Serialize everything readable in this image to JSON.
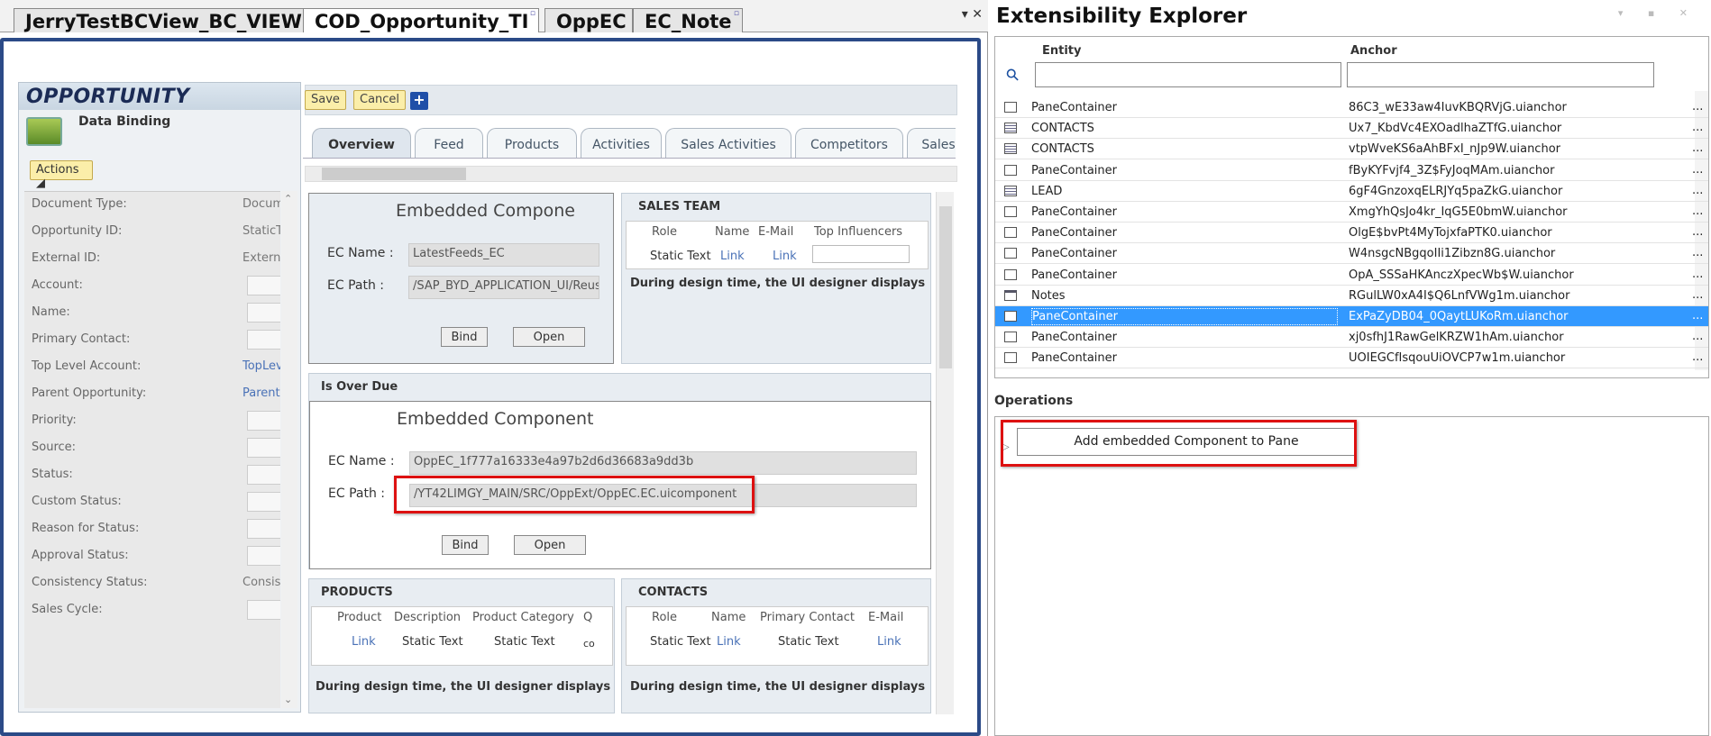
{
  "doc_tabs": [
    {
      "label": "JerryTestBCView_BC_VIEW",
      "active": false,
      "locked": false
    },
    {
      "label": "COD_Opportunity_TI",
      "active": true,
      "locked": true
    },
    {
      "label": "OppEC",
      "active": false,
      "locked": false
    },
    {
      "label": "EC_Note",
      "active": false,
      "locked": true
    }
  ],
  "tabstrip_controls": "▾ ✕",
  "sidebar": {
    "title": "OPPORTUNITY",
    "subtitle": "Data Binding",
    "actions_label": "Actions ◢",
    "fields": [
      {
        "label": "Document Type:",
        "value": "Document",
        "kind": "text"
      },
      {
        "label": "Opportunity ID:",
        "value": "StaticText",
        "kind": "text"
      },
      {
        "label": "External ID:",
        "value": "External",
        "kind": "text"
      },
      {
        "label": "Account:",
        "value": "",
        "kind": "box"
      },
      {
        "label": "Name:",
        "value": "",
        "kind": "box"
      },
      {
        "label": "Primary Contact:",
        "value": "",
        "kind": "box"
      },
      {
        "label": "Top Level Account:",
        "value": "TopLevel",
        "kind": "link"
      },
      {
        "label": "Parent Opportunity:",
        "value": "Parent",
        "kind": "link"
      },
      {
        "label": "Priority:",
        "value": "",
        "kind": "box"
      },
      {
        "label": "Source:",
        "value": "",
        "kind": "box"
      },
      {
        "label": "Status:",
        "value": "",
        "kind": "box"
      },
      {
        "label": "Custom Status:",
        "value": "",
        "kind": "box"
      },
      {
        "label": "Reason for Status:",
        "value": "",
        "kind": "box"
      },
      {
        "label": "Approval Status:",
        "value": "",
        "kind": "box"
      },
      {
        "label": "Consistency Status:",
        "value": "Consistent",
        "kind": "text"
      },
      {
        "label": "Sales Cycle:",
        "value": "",
        "kind": "box"
      }
    ]
  },
  "toolbar": {
    "save": "Save",
    "cancel": "Cancel",
    "plus": "+"
  },
  "view_tabs": [
    "Overview",
    "Feed",
    "Products",
    "Activities",
    "Sales Activities",
    "Competitors",
    "Sales"
  ],
  "ec1": {
    "title": "Embedded Component",
    "name_label": "EC Name :",
    "name_value": "LatestFeeds_EC",
    "path_label": "EC Path :",
    "path_value": "/SAP_BYD_APPLICATION_UI/Reuse",
    "bind": "Bind",
    "open": "Open"
  },
  "sales_team": {
    "title": "SALES TEAM",
    "columns": [
      "Role",
      "Name",
      "E-Mail",
      "Top Influencers"
    ],
    "row": [
      "Static Text",
      "Link",
      "Link",
      ""
    ],
    "note": "During design time, the UI designer displays only"
  },
  "overdue": {
    "title": "Is Over Due",
    "ec_title": "Embedded Component",
    "name_label": "EC Name :",
    "name_value": "OppEC_1f777a16333e4a97b2d6d36683a9dd3b",
    "path_label": "EC Path :",
    "path_value": "/YT42LIMGY_MAIN/SRC/OppExt/OppEC.EC.uicomponent",
    "bind": "Bind",
    "open": "Open"
  },
  "products": {
    "title": "PRODUCTS",
    "columns": [
      "Product",
      "Description",
      "Product Category",
      "Q"
    ],
    "row": [
      "Link",
      "Static Text",
      "Static Text",
      "co"
    ],
    "note": "During design time, the UI designer displays only"
  },
  "contacts": {
    "title": "CONTACTS",
    "columns": [
      "Role",
      "Name",
      "Primary Contact",
      "E-Mail"
    ],
    "row": [
      "Static Text",
      "Link",
      "Static Text",
      "Link"
    ],
    "note": "During design time, the UI designer displays only"
  },
  "explorer": {
    "title": "Extensibility Explorer",
    "controls": "▾ ▪ ✕",
    "col_entity": "Entity",
    "col_anchor": "Anchor",
    "search_icon": "⚲",
    "dots": "...",
    "rows": [
      {
        "icon": "pane",
        "entity": "PaneContainer",
        "anchor": "86C3_wE33aw4IuvKBQRVjG.uianchor",
        "selected": false
      },
      {
        "icon": "list",
        "entity": "CONTACTS",
        "anchor": "Ux7_KbdVc4EXOadlhaZTfG.uianchor",
        "selected": false
      },
      {
        "icon": "list",
        "entity": "CONTACTS",
        "anchor": "vtpWveKS6aAhBFxI_nJp9W.uianchor",
        "selected": false
      },
      {
        "icon": "pane",
        "entity": "PaneContainer",
        "anchor": "fByKYFvjf4_3Z$FyJoqMAm.uianchor",
        "selected": false
      },
      {
        "icon": "list",
        "entity": "LEAD",
        "anchor": "6gF4GnzoxqELRJYq5paZkG.uianchor",
        "selected": false
      },
      {
        "icon": "pane",
        "entity": "PaneContainer",
        "anchor": "XmgYhQsJo4kr_IqG5E0bmW.uianchor",
        "selected": false
      },
      {
        "icon": "pane",
        "entity": "PaneContainer",
        "anchor": "OlgE$bvPt4MyTojxfaPTK0.uianchor",
        "selected": false
      },
      {
        "icon": "pane",
        "entity": "PaneContainer",
        "anchor": "W4nsgcNBgqoIIi1Zibzn8G.uianchor",
        "selected": false
      },
      {
        "icon": "pane",
        "entity": "PaneContainer",
        "anchor": "OpA_SSSaHKAnczXpecWb$W.uianchor",
        "selected": false
      },
      {
        "icon": "notes",
        "entity": "Notes",
        "anchor": "RGulLW0xA4I$Q6LnfVWg1m.uianchor",
        "selected": false
      },
      {
        "icon": "pane",
        "entity": "PaneContainer",
        "anchor": "ExPaZyDB04_0QaytLUKoRm.uianchor",
        "selected": true
      },
      {
        "icon": "pane",
        "entity": "PaneContainer",
        "anchor": "xj0sfhJ1RawGelKRZW1hAm.uianchor",
        "selected": false
      },
      {
        "icon": "pane",
        "entity": "PaneContainer",
        "anchor": "UOIEGCfIsqouUiOVCP7w1m.uianchor",
        "selected": false
      }
    ]
  },
  "operations": {
    "title": "Operations",
    "button": "Add embedded Component to Pane"
  },
  "colors": {
    "frame": "#2b4a87",
    "highlight": "#d11111",
    "selection": "#3399ff",
    "link": "#4a72b7"
  }
}
